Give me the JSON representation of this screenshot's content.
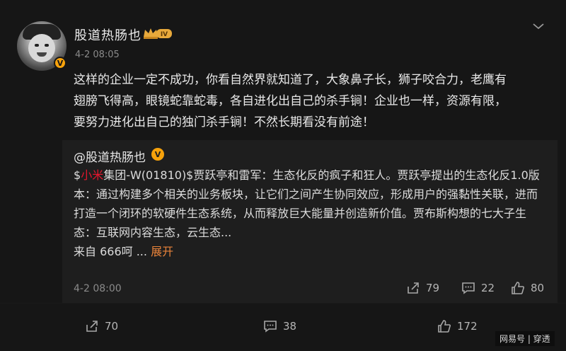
{
  "post": {
    "username": "股道热肠也",
    "level_badge": "IV",
    "verified_mark": "V",
    "time": "4-2 08:05",
    "text": "这样的企业一定不成功，你看自然界就知道了，大象鼻子长，狮子咬合力，老鹰有\n翅膀飞得高，眼镜蛇靠蛇毒，各自进化出自己的杀手锏！企业也一样，资源有限，\n要努力进化出自己的独门杀手锏！不然长期看没有前途！"
  },
  "quote": {
    "username": "@股道热肠也",
    "verified_mark": "V",
    "text_prefix": "$",
    "text_highlight": "小米",
    "text_body": "集团-W(01810)$贾跃亭和雷军：生态化反的疯子和狂人。贾跃亭提出的生态化反1.0版本：通过构建多个相关的业务板块，让它们之间产生协同效应，形成用户的强黏性关联，进而打造一个闭环的软硬件生态系统，从而释放巨大能量并创造新价值。贾布斯构想的七大子生态：互联网内容生态，云生态...",
    "source": "来自 666呵 ... ",
    "expand_label": "展开",
    "time": "4-2 08:00",
    "stats": {
      "reposts": "79",
      "comments": "22",
      "likes": "80"
    }
  },
  "stats": {
    "reposts": "70",
    "comments": "38",
    "likes": "172"
  },
  "watermark": "网易号 | 穿透",
  "colors": {
    "background": "#161616",
    "quote_bg": "#1e1e1e",
    "highlight": "#e6162d",
    "expand": "#e8833a",
    "badge": "#f7a20b"
  },
  "icons": [
    "chevron-down-icon",
    "repost-icon",
    "comment-icon",
    "like-icon",
    "crown-badge-icon",
    "verified-icon"
  ]
}
